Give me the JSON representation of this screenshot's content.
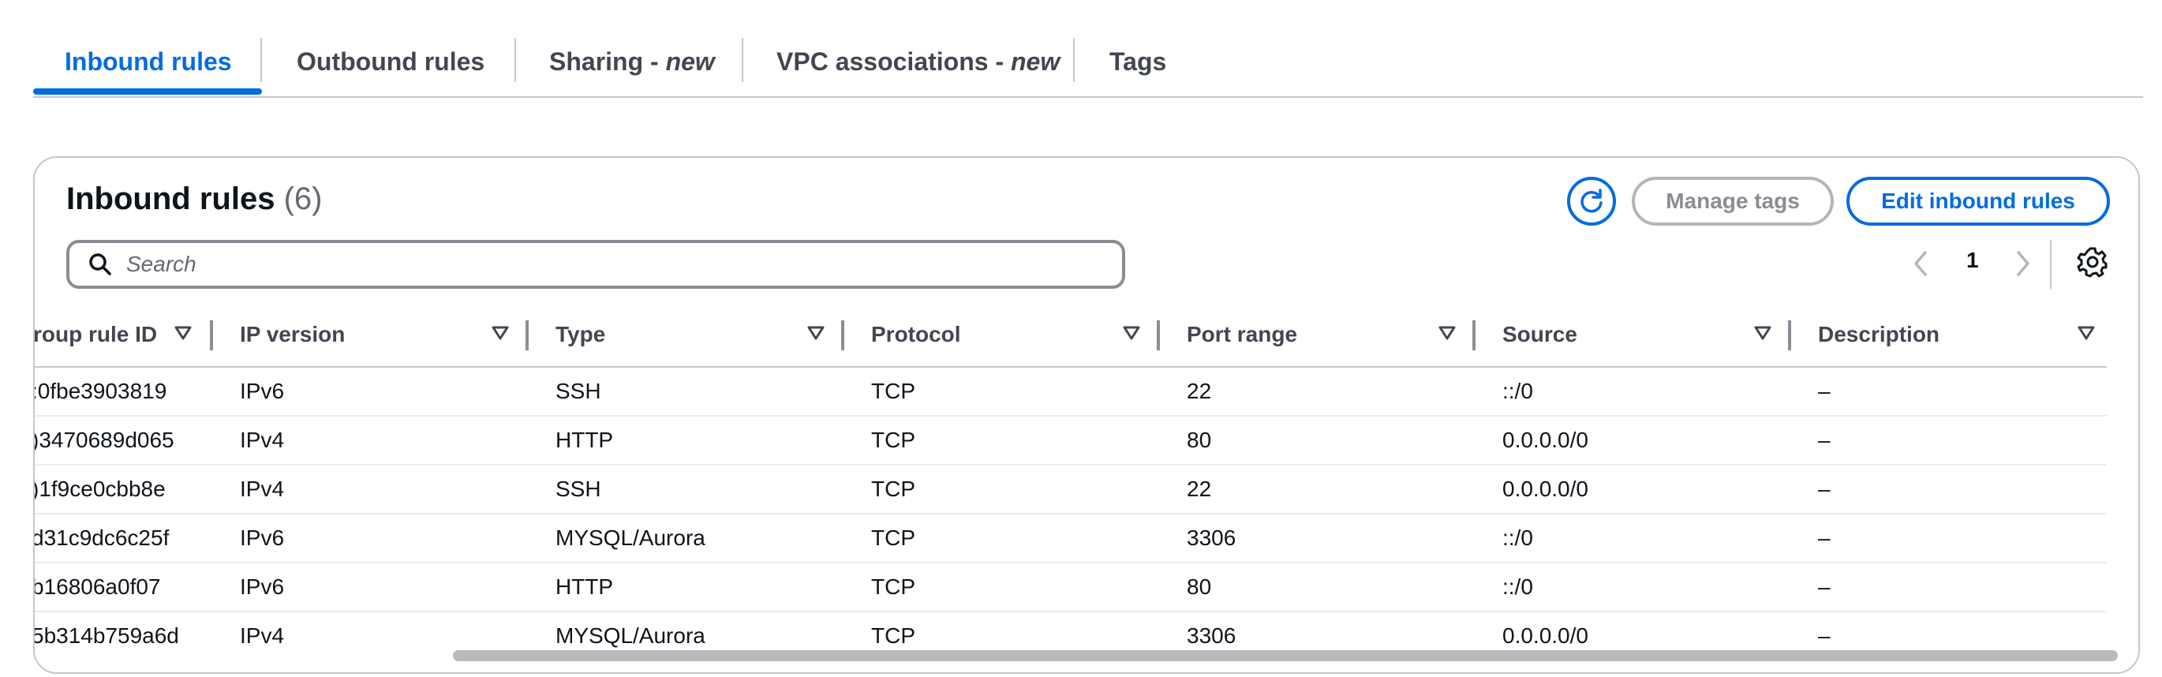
{
  "tabs": [
    {
      "label": "Inbound rules",
      "suffix": ""
    },
    {
      "label": "Outbound rules",
      "suffix": ""
    },
    {
      "label": "Sharing - ",
      "suffix": "new"
    },
    {
      "label": "VPC associations - ",
      "suffix": "new"
    },
    {
      "label": "Tags",
      "suffix": ""
    }
  ],
  "panel": {
    "title": "Inbound rules",
    "count": "(6)",
    "manage_tags": "Manage tags",
    "edit_rules": "Edit inbound rules",
    "search_placeholder": "Search",
    "page": "1"
  },
  "columns": [
    "roup rule ID",
    "IP version",
    "Type",
    "Protocol",
    "Port range",
    "Source",
    "Description"
  ],
  "rows": [
    {
      "id": ":0fbe3903819",
      "ip": "IPv6",
      "type": "SSH",
      "protocol": "TCP",
      "port": "22",
      "source": "::/0",
      "desc": "–"
    },
    {
      "id": ")3470689d065",
      "ip": "IPv4",
      "type": "HTTP",
      "protocol": "TCP",
      "port": "80",
      "source": "0.0.0.0/0",
      "desc": "–"
    },
    {
      "id": ")1f9ce0cbb8e",
      "ip": "IPv4",
      "type": "SSH",
      "protocol": "TCP",
      "port": "22",
      "source": "0.0.0.0/0",
      "desc": "–"
    },
    {
      "id": "d31c9dc6c25f",
      "ip": "IPv6",
      "type": "MYSQL/Aurora",
      "protocol": "TCP",
      "port": "3306",
      "source": "::/0",
      "desc": "–"
    },
    {
      "id": "b16806a0f07",
      "ip": "IPv6",
      "type": "HTTP",
      "protocol": "TCP",
      "port": "80",
      "source": "::/0",
      "desc": "–"
    },
    {
      "id": "5b314b759a6d",
      "ip": "IPv4",
      "type": "MYSQL/Aurora",
      "protocol": "TCP",
      "port": "3306",
      "source": "0.0.0.0/0",
      "desc": "–"
    }
  ],
  "colors": {
    "accent": "#006ce0",
    "border": "#c6c6cd",
    "disabled": "#8c8c94"
  }
}
